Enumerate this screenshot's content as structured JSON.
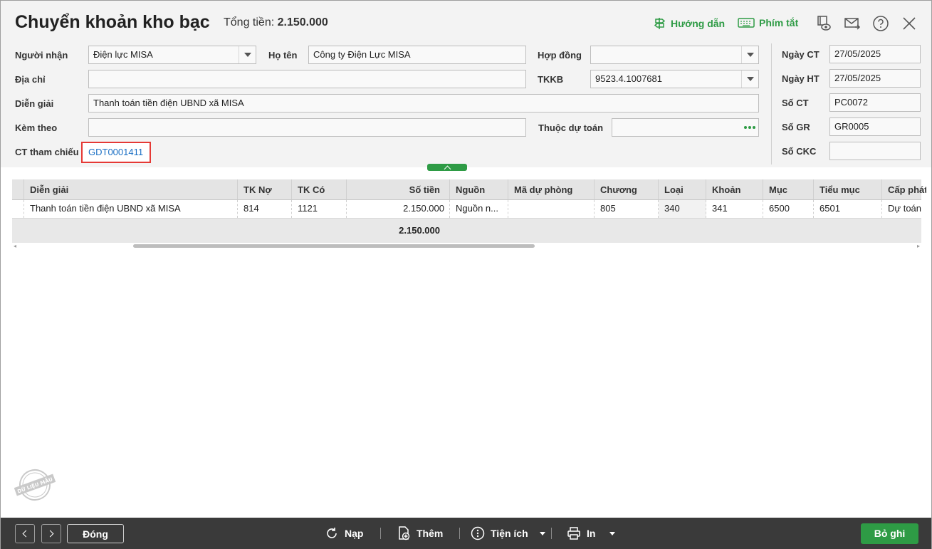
{
  "header": {
    "title": "Chuyển khoản kho bạc",
    "total_label": "Tổng tiền:",
    "total_value": "2.150.000",
    "guide_label": "Hướng dẫn",
    "shortcut_label": "Phím tắt"
  },
  "form": {
    "recipient": {
      "label": "Người nhận",
      "value": "Điện lực MISA"
    },
    "fullname": {
      "label": "Họ tên",
      "value": "Công ty Điện Lực MISA"
    },
    "contract": {
      "label": "Hợp đồng",
      "value": ""
    },
    "address": {
      "label": "Địa chỉ",
      "value": ""
    },
    "tkkb": {
      "label": "TKKB",
      "value": "9523.4.1007681"
    },
    "description": {
      "label": "Diễn giải",
      "value": "Thanh toán tiền điện UBND xã MISA"
    },
    "attached": {
      "label": "Kèm theo",
      "value": ""
    },
    "budget": {
      "label": "Thuộc dự toán",
      "value": ""
    },
    "reference": {
      "label": "CT tham chiếu",
      "value": "GDT0001411"
    }
  },
  "side": {
    "ngay_ct": {
      "label": "Ngày CT",
      "value": "27/05/2025"
    },
    "ngay_ht": {
      "label": "Ngày HT",
      "value": "27/05/2025"
    },
    "so_ct": {
      "label": "Số CT",
      "value": "PC0072"
    },
    "so_gr": {
      "label": "Số GR",
      "value": "GR0005"
    },
    "so_ckc": {
      "label": "Số CKC",
      "value": ""
    }
  },
  "grid": {
    "columns": [
      "Diễn giải",
      "TK Nợ",
      "TK Có",
      "Số tiền",
      "Nguồn",
      "Mã dự phòng",
      "Chương",
      "Loại",
      "Khoản",
      "Mục",
      "Tiểu mục",
      "Cấp phát"
    ],
    "rows": [
      [
        "Thanh toán tiền điện UBND xã MISA",
        "814",
        "1121",
        "2.150.000",
        "Nguồn n...",
        "",
        "805",
        "340",
        "341",
        "6500",
        "6501",
        "Dự toán"
      ]
    ],
    "total": "2.150.000"
  },
  "stamp_text": "DỮ LIỆU MẪU",
  "footer": {
    "close_label": "Đóng",
    "reload_label": "Nạp",
    "add_label": "Thêm",
    "utility_label": "Tiện ích",
    "print_label": "In",
    "save_label": "Bỏ ghi"
  },
  "colors": {
    "accent": "#2e9b45",
    "highlight": "#e53935",
    "link": "#1a6fc4",
    "footer_bg": "#3a3a3a"
  }
}
